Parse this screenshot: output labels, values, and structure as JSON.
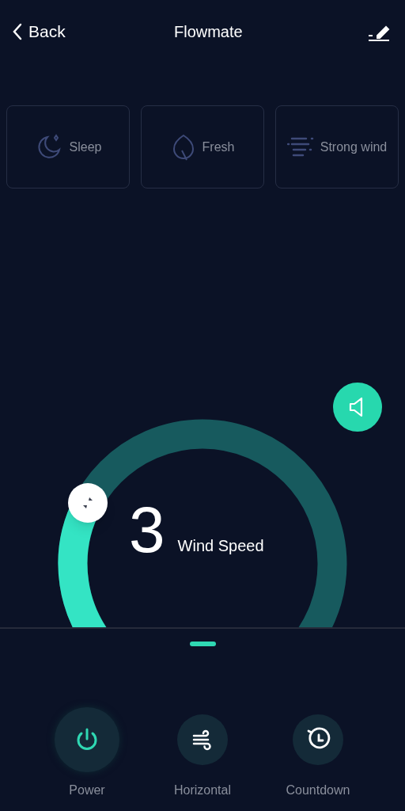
{
  "header": {
    "back": "Back",
    "title": "Flowmate"
  },
  "modes": [
    {
      "kind": "sleep",
      "label": "Sleep",
      "selected": false
    },
    {
      "kind": "fresh",
      "label": "Fresh",
      "selected": false
    },
    {
      "kind": "strong",
      "label": "Strong wind",
      "selected": false
    }
  ],
  "dial": {
    "value": "3",
    "label": "Wind Speed"
  },
  "controls": [
    {
      "kind": "power",
      "label": "Power",
      "active": true
    },
    {
      "kind": "horizontal",
      "label": "Horizontal",
      "active": false
    },
    {
      "kind": "countdown",
      "label": "Countdown",
      "active": false
    }
  ]
}
